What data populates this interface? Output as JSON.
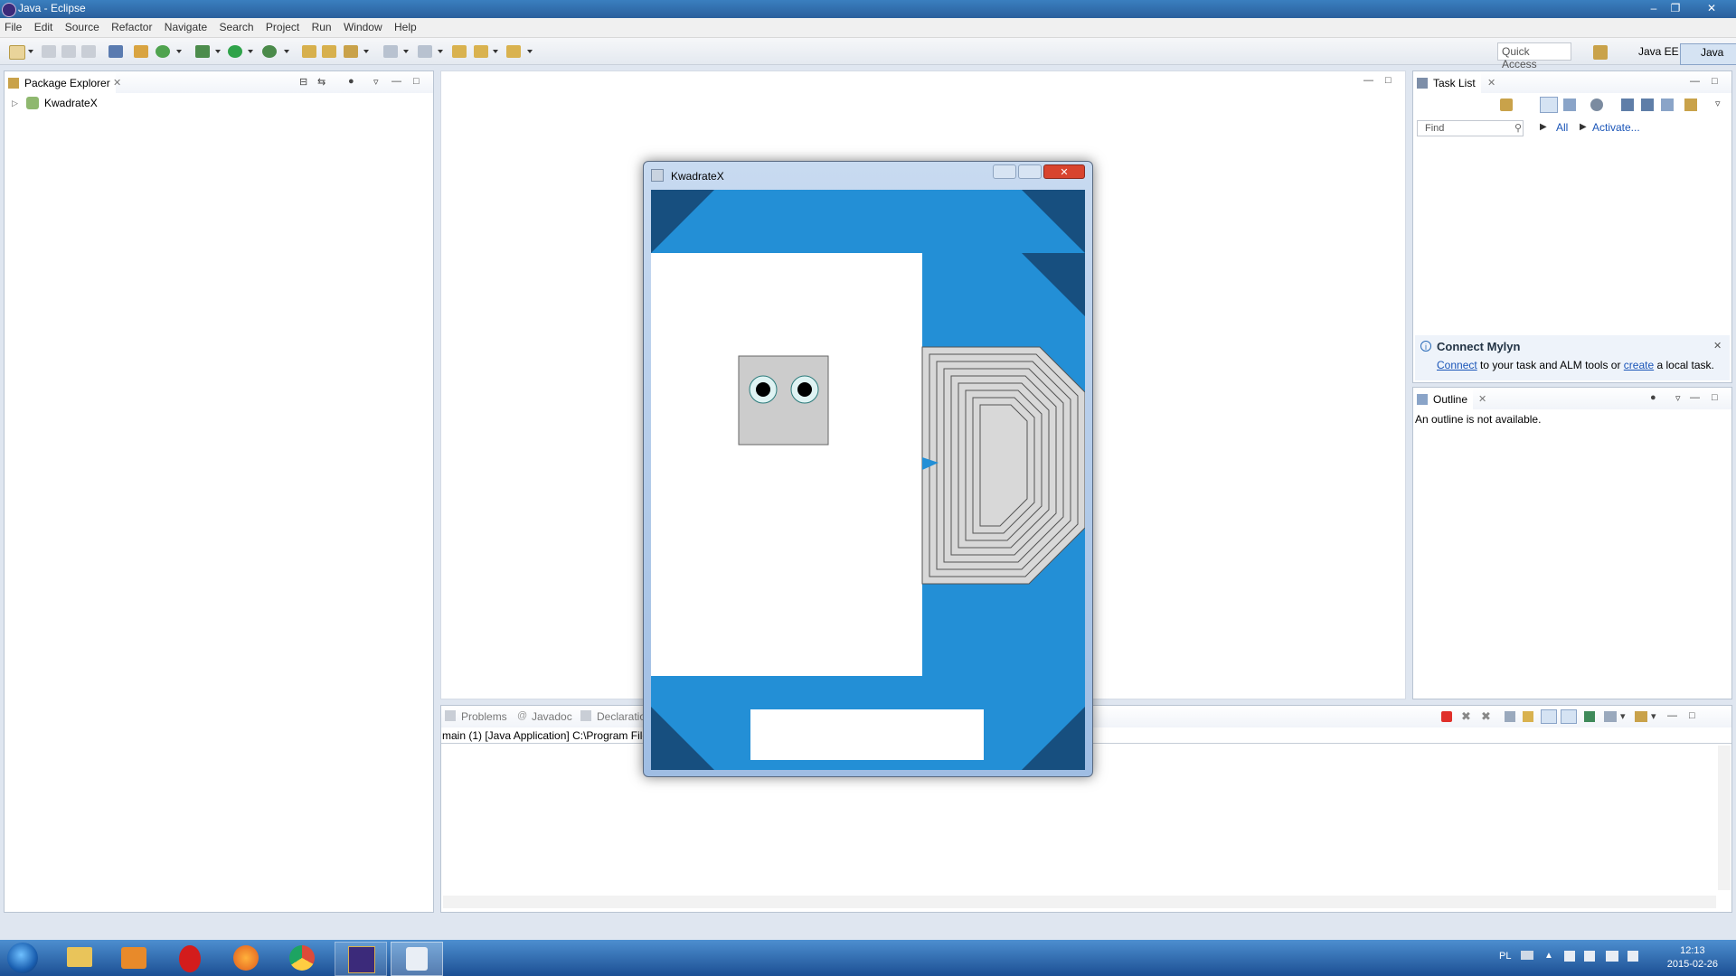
{
  "window": {
    "title": "Java - Eclipse"
  },
  "menu": [
    "File",
    "Edit",
    "Source",
    "Refactor",
    "Navigate",
    "Search",
    "Project",
    "Run",
    "Window",
    "Help"
  ],
  "quick_access": {
    "placeholder": "Quick Access"
  },
  "perspectives": [
    "Java EE",
    "Java"
  ],
  "package_explorer": {
    "tab": "Package Explorer",
    "items": [
      "KwadrateX"
    ]
  },
  "task_list": {
    "tab": "Task List",
    "find_placeholder": "Find",
    "all_label": "All",
    "activate_label": "Activate..."
  },
  "mylyn": {
    "title": "Connect Mylyn",
    "connect": "Connect",
    "middle": " to your task and ALM tools or ",
    "create": "create",
    "end": " a local task."
  },
  "outline": {
    "tab": "Outline",
    "message": "An outline is not available."
  },
  "bottom_panel": {
    "tabs": [
      "Problems",
      "Javadoc",
      "Declaratio"
    ],
    "console_line": "main (1) [Java Application] C:\\Program File"
  },
  "app_window": {
    "title": "KwadrateX"
  },
  "taskbar": {
    "lang": "PL",
    "time": "12:13",
    "date": "2015-02-26"
  },
  "colors": {
    "app_bg": "#238fd6",
    "app_dark": "#174f7f",
    "title_bar": "#2a5f9c"
  }
}
